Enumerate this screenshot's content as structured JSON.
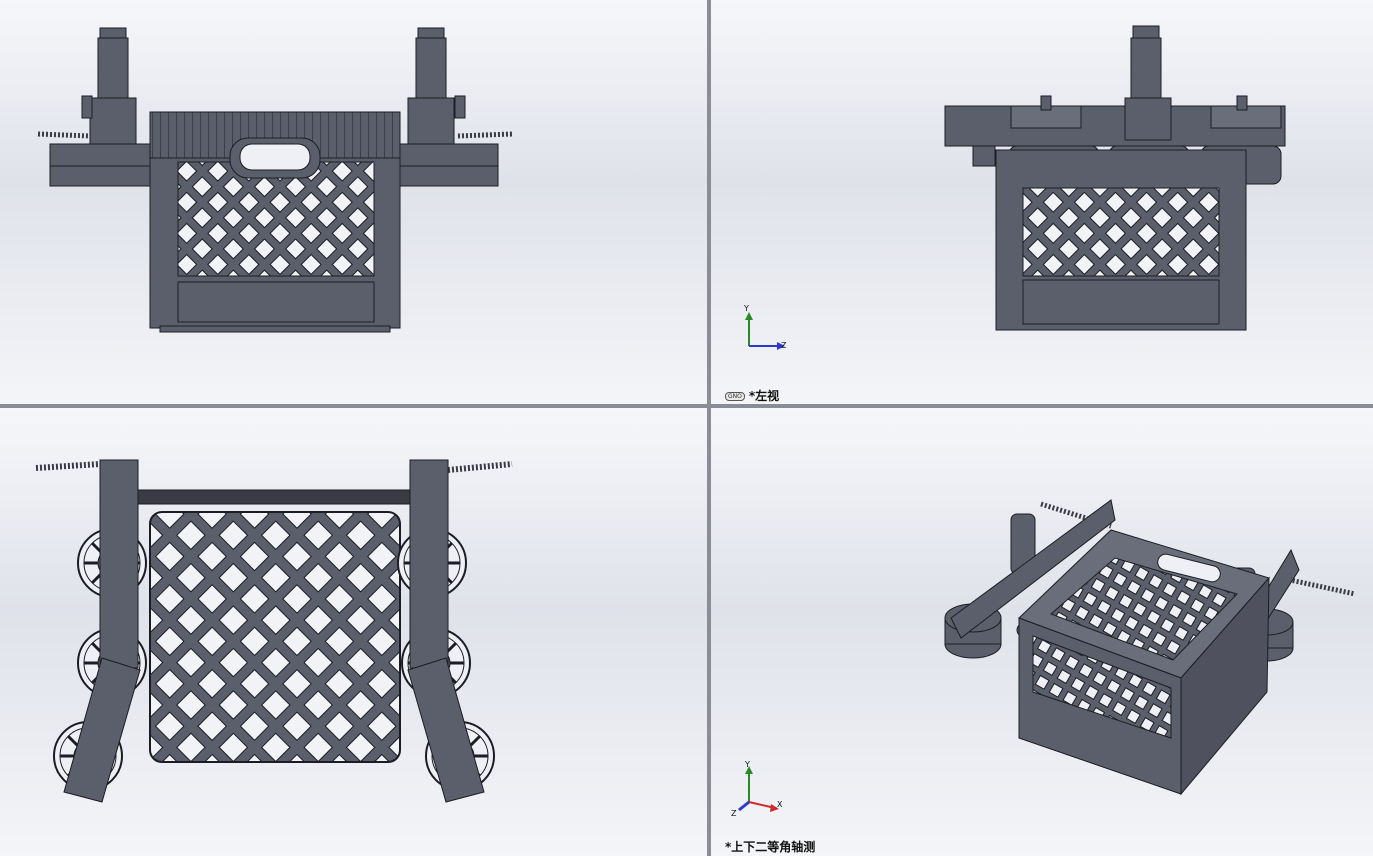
{
  "viewports": {
    "top_left": {
      "label": ""
    },
    "top_right": {
      "label": "*左视",
      "badge": "GNO"
    },
    "bottom_left": {
      "label": ""
    },
    "bottom_right": {
      "label": "*上下二等角轴测"
    }
  },
  "triad": {
    "x": "X",
    "y": "Y",
    "z": "Z"
  },
  "colors": {
    "model": "#5b5e6b",
    "edge": "#1c1d24",
    "bg_top": "#f6f7fa",
    "bg_mid": "#dfe2ea"
  }
}
